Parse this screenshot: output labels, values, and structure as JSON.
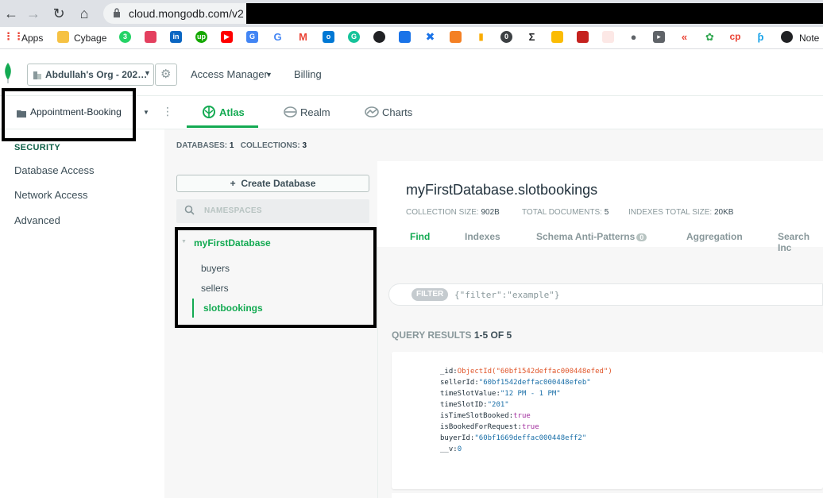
{
  "browser": {
    "url": "cloud.mongodb.com/v2",
    "bookmarks": [
      "Apps",
      "Cybage",
      "Note"
    ]
  },
  "topnav": {
    "org": "Abdullah's Org - 202…",
    "access_manager": "Access Manager",
    "billing": "Billing"
  },
  "project": {
    "name": "Appointment-Booking",
    "tabs": [
      "Atlas",
      "Realm",
      "Charts"
    ]
  },
  "leftnav": {
    "section": "SECURITY",
    "items": [
      "Database Access",
      "Network Access",
      "Advanced"
    ]
  },
  "databases": {
    "databases_label": "DATABASES:",
    "databases_count": "1",
    "collections_label": "COLLECTIONS:",
    "collections_count": "3",
    "create_button": "Create Database",
    "namespaces_placeholder": "NAMESPACES",
    "db_name": "myFirstDatabase",
    "collections": [
      "buyers",
      "sellers",
      "slotbookings"
    ]
  },
  "collection": {
    "title": "myFirstDatabase.slotbookings",
    "size_label": "COLLECTION SIZE:",
    "size_value": "902B",
    "docs_label": "TOTAL DOCUMENTS:",
    "docs_value": "5",
    "index_label": "INDEXES TOTAL SIZE:",
    "index_value": "20KB",
    "tabs": [
      "Find",
      "Indexes",
      "Schema Anti-Patterns",
      "Aggregation",
      "Search Inc"
    ],
    "anti_patterns_badge": "0",
    "filter_label": "FILTER",
    "filter_placeholder": "{\"filter\":\"example\"}",
    "query_results_label": "QUERY RESULTS",
    "query_results_range": "1-5 OF 5"
  },
  "document": {
    "_id": "ObjectId(\"60bf1542deffac000448efed\")",
    "sellerId": "\"60bf1542deffac000448efeb\"",
    "timeSlotValue": "\"12 PM - 1 PM\"",
    "timeSlotID": "\"201\"",
    "isTimeSlotBooked": "true",
    "isBookedForRequest": "true",
    "buyerId": "\"60bf1669deffac000448eff2\"",
    "__v": "0"
  },
  "colors": {
    "accent": "#13aa52",
    "text": "#3d4f58"
  }
}
